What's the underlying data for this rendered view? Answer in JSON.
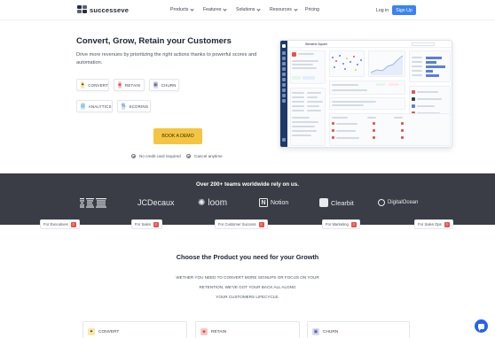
{
  "nav": {
    "brand": "successeve",
    "menu": [
      {
        "label": "Products"
      },
      {
        "label": "Features"
      },
      {
        "label": "Solutions"
      },
      {
        "label": "Resources"
      },
      {
        "label": "Pricing"
      }
    ],
    "login": "Log in",
    "signup": "Sign Up"
  },
  "hero": {
    "title": "Convert, Grow, Retain your Customers",
    "description": "Drive more revenues by prioritizing the right actions thanks to powerful scores and automation.",
    "products": [
      {
        "label": "CONVERT",
        "icon": "convert-icon",
        "color": "#f6c343"
      },
      {
        "label": "RETAIN",
        "icon": "retain-icon",
        "color": "#e2554f"
      },
      {
        "label": "CHURN",
        "icon": "churn-icon",
        "color": "#5c5f9e"
      },
      {
        "label": "ANALYTICS",
        "icon": "analytics-icon",
        "color": "#4a9fd8"
      },
      {
        "label": "SCORING",
        "icon": "scoring-icon",
        "color": "#3e6fb8"
      }
    ],
    "cta": "BOOK A DEMO",
    "checks": [
      "No credit card required",
      "Cancel anytime"
    ]
  },
  "mockup": {
    "title": "Westend Square"
  },
  "band": {
    "title": "Over 200+ teams worldwide rely on us.",
    "logos": [
      {
        "name": "IBM",
        "icon": "ibm-logo"
      },
      {
        "name": "JCDecaux",
        "icon": "jcdecaux-logo"
      },
      {
        "name": "loom",
        "icon": "loom-logo"
      },
      {
        "name": "Notion",
        "icon": "notion-logo"
      },
      {
        "name": "Clearbit",
        "icon": "clearbit-logo"
      },
      {
        "name": "DigitalOcean",
        "icon": "digitalocean-logo"
      }
    ],
    "tags": [
      {
        "label": "For Executives"
      },
      {
        "label": "For Sales"
      },
      {
        "label": "For Customer Success"
      },
      {
        "label": "For Marketing"
      },
      {
        "label": "For Sales Ops"
      }
    ]
  },
  "choose": {
    "title": "Choose the Product you need for your Growth",
    "lines": [
      "WETHER YOU NEED TO CONVERT MORE SIGNUPS OR FOCUS ON YOUR",
      "RETENTION, WE'VE GOT YOUR BACK ALL ALONG",
      "YOUR CUSTOMERS LIFECYCLE."
    ],
    "cards": [
      {
        "label": "CONVERT",
        "color": "#f6c343"
      },
      {
        "label": "RETAIN",
        "color": "#e2554f"
      },
      {
        "label": "CHURN",
        "color": "#5c5f9e"
      }
    ]
  },
  "colors": {
    "accent": "#3b82f6",
    "cta": "#f4c542",
    "band": "#3a3d45"
  }
}
